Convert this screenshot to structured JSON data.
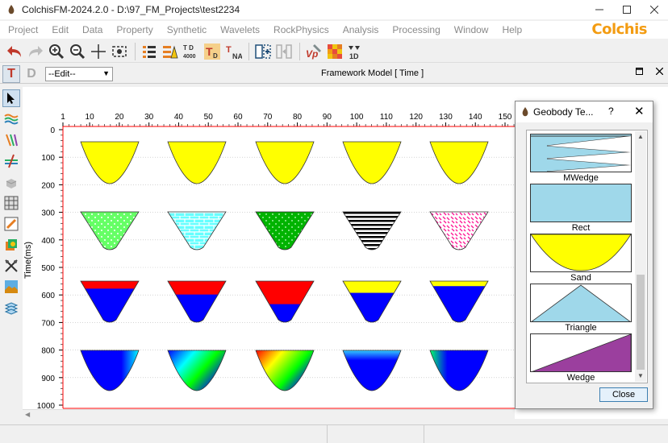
{
  "window": {
    "title": "ColchisFM-2024.2.0 - D:\\97_FM_Projects\\test2234",
    "controls": [
      "minimize",
      "maximize",
      "close"
    ]
  },
  "menu": {
    "items": [
      "Project",
      "Edit",
      "Data",
      "Property",
      "Synthetic",
      "Wavelets",
      "RockPhysics",
      "Analysis",
      "Processing",
      "Window",
      "Help"
    ],
    "brand": "Colchis"
  },
  "toolbar": {
    "icons": [
      "undo-icon",
      "redo-icon",
      "zoom-in-icon",
      "zoom-out-icon",
      "crosshair-icon",
      "screenshot-icon",
      "layers-icon",
      "layers-warning-icon",
      "depth-4000-icon",
      "depth-t-icon",
      "depth-dna-icon",
      "add-panel-icon",
      "split-panel-icon",
      "vp-icon",
      "heatmap-icon",
      "1d-icon"
    ],
    "label_4000": "4000",
    "label_1d": "1D"
  },
  "subbar": {
    "t_label": "T",
    "d_label": "D",
    "edit_select": "--Edit--",
    "model_title": "Framework Model [ Time ]"
  },
  "axes": {
    "x_ticks": [
      "1",
      "10",
      "20",
      "30",
      "40",
      "50",
      "60",
      "70",
      "80",
      "90",
      "100",
      "110",
      "120",
      "130",
      "140",
      "150"
    ],
    "y_ticks": [
      "0",
      "100",
      "200",
      "300",
      "400",
      "500",
      "600",
      "700",
      "800",
      "900",
      "1000"
    ],
    "y_label": "Time(ms)"
  },
  "geobodies": {
    "row1_fill": "#ffff00",
    "red": "#ff0000",
    "blue": "#0000ff",
    "yellow": "#ffff00"
  },
  "dialog": {
    "title": "Geobody Te...",
    "help": "?",
    "close_x": "✕",
    "items": [
      {
        "label": "MWedge"
      },
      {
        "label": "Rect"
      },
      {
        "label": "Sand"
      },
      {
        "label": "Triangle"
      },
      {
        "label": "Wedge"
      }
    ],
    "close_button": "Close"
  }
}
